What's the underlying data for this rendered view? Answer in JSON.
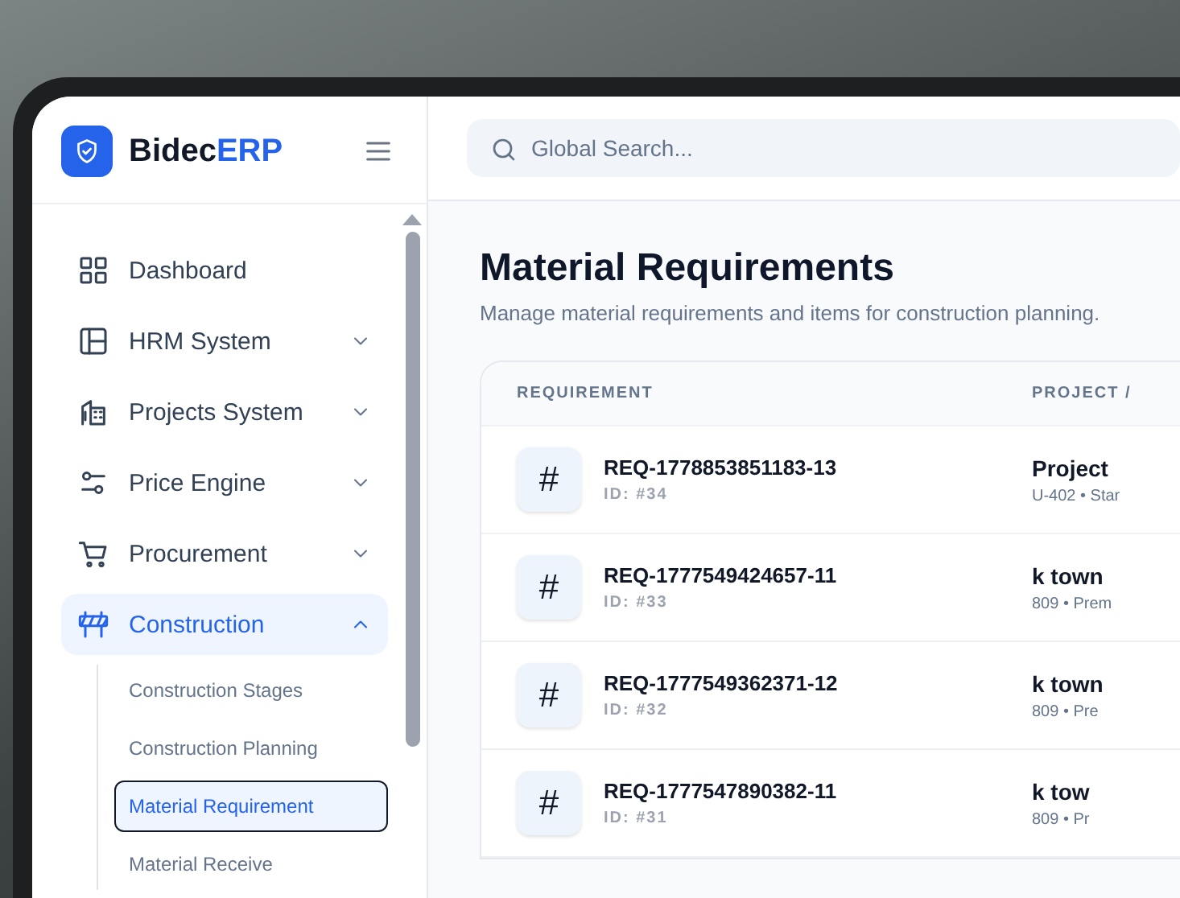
{
  "brand": {
    "name": "Bidec",
    "accent": "ERP"
  },
  "sidebar": {
    "items": [
      {
        "label": "Dashboard",
        "selected": false
      },
      {
        "label": "HRM System",
        "selected": false,
        "expanded": false
      },
      {
        "label": "Projects System",
        "selected": false,
        "expanded": false
      },
      {
        "label": "Price Engine",
        "selected": false,
        "expanded": false
      },
      {
        "label": "Procurement",
        "selected": false,
        "expanded": false
      },
      {
        "label": "Construction",
        "selected": true,
        "expanded": true,
        "children": [
          {
            "label": "Construction Stages",
            "selected": false
          },
          {
            "label": "Construction Planning",
            "selected": false
          },
          {
            "label": "Material Requirement",
            "selected": true
          },
          {
            "label": "Material Receive",
            "selected": false
          }
        ]
      }
    ]
  },
  "search": {
    "placeholder": "Global Search..."
  },
  "page": {
    "title": "Material Requirements",
    "subtitle": "Manage material requirements and items for construction planning."
  },
  "table": {
    "columns": [
      "REQUIREMENT",
      "PROJECT /"
    ],
    "rows": [
      {
        "badge": "#",
        "code": "REQ-1778853851183-13",
        "id": "ID: #34",
        "project": "Project",
        "detail": "U-402 • Star"
      },
      {
        "badge": "#",
        "code": "REQ-1777549424657-11",
        "id": "ID: #33",
        "project": "k town",
        "detail": "809 • Prem"
      },
      {
        "badge": "#",
        "code": "REQ-1777549362371-12",
        "id": "ID: #32",
        "project": "k town",
        "detail": "809 • Pre"
      },
      {
        "badge": "#",
        "code": "REQ-1777547890382-11",
        "id": "ID: #31",
        "project": "k tow",
        "detail": "809 • Pr"
      }
    ]
  }
}
